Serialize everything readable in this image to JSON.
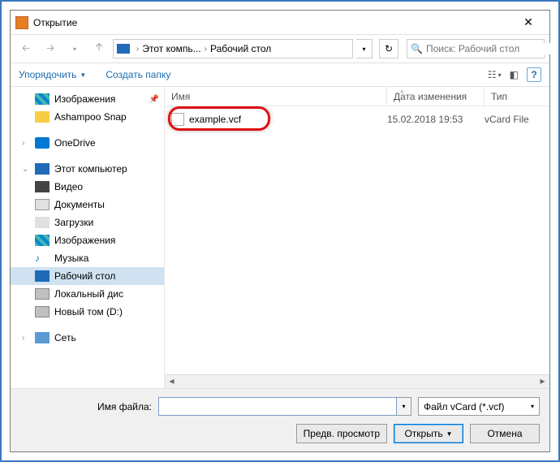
{
  "window": {
    "title": "Открытие"
  },
  "breadcrumb": {
    "part1": "Этот компь...",
    "part2": "Рабочий стол"
  },
  "search": {
    "placeholder": "Поиск: Рабочий стол"
  },
  "toolbar": {
    "organize": "Упорядочить",
    "new_folder": "Создать папку",
    "help": "?"
  },
  "tree": {
    "pictures": "Изображения",
    "ashampoo": "Ashampoo Snap",
    "onedrive": "OneDrive",
    "this_pc": "Этот компьютер",
    "video": "Видео",
    "documents": "Документы",
    "downloads": "Загрузки",
    "pictures2": "Изображения",
    "music": "Музыка",
    "desktop": "Рабочий стол",
    "local_disk": "Локальный дис",
    "new_vol": "Новый том (D:)",
    "network": "Сеть"
  },
  "columns": {
    "name": "Имя",
    "date": "Дата изменения",
    "type": "Тип"
  },
  "file": {
    "name": "example.vcf",
    "date": "15.02.2018 19:53",
    "type": "vCard File"
  },
  "bottom": {
    "filename_label": "Имя файла:",
    "filename_value": "",
    "filter": "Файл vCard (*.vcf)",
    "preview": "Предв. просмотр",
    "open": "Открыть",
    "cancel": "Отмена"
  }
}
